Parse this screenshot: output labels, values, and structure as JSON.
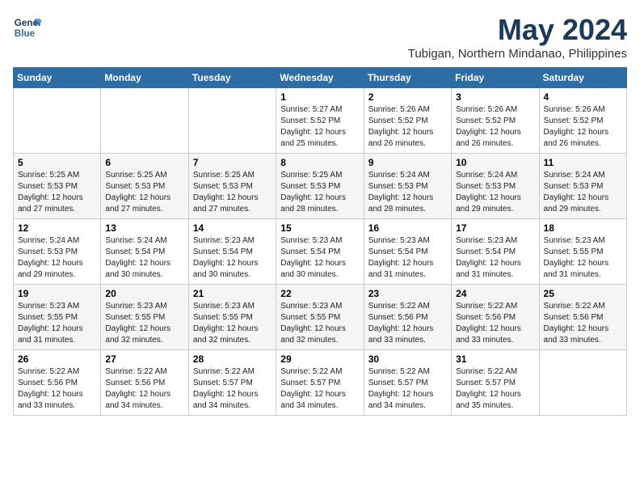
{
  "logo": {
    "line1": "General",
    "line2": "Blue"
  },
  "title": "May 2024",
  "location": "Tubigan, Northern Mindanao, Philippines",
  "headers": [
    "Sunday",
    "Monday",
    "Tuesday",
    "Wednesday",
    "Thursday",
    "Friday",
    "Saturday"
  ],
  "weeks": [
    [
      {
        "day": "",
        "info": ""
      },
      {
        "day": "",
        "info": ""
      },
      {
        "day": "",
        "info": ""
      },
      {
        "day": "1",
        "info": "Sunrise: 5:27 AM\nSunset: 5:52 PM\nDaylight: 12 hours\nand 25 minutes."
      },
      {
        "day": "2",
        "info": "Sunrise: 5:26 AM\nSunset: 5:52 PM\nDaylight: 12 hours\nand 26 minutes."
      },
      {
        "day": "3",
        "info": "Sunrise: 5:26 AM\nSunset: 5:52 PM\nDaylight: 12 hours\nand 26 minutes."
      },
      {
        "day": "4",
        "info": "Sunrise: 5:26 AM\nSunset: 5:52 PM\nDaylight: 12 hours\nand 26 minutes."
      }
    ],
    [
      {
        "day": "5",
        "info": "Sunrise: 5:25 AM\nSunset: 5:53 PM\nDaylight: 12 hours\nand 27 minutes."
      },
      {
        "day": "6",
        "info": "Sunrise: 5:25 AM\nSunset: 5:53 PM\nDaylight: 12 hours\nand 27 minutes."
      },
      {
        "day": "7",
        "info": "Sunrise: 5:25 AM\nSunset: 5:53 PM\nDaylight: 12 hours\nand 27 minutes."
      },
      {
        "day": "8",
        "info": "Sunrise: 5:25 AM\nSunset: 5:53 PM\nDaylight: 12 hours\nand 28 minutes."
      },
      {
        "day": "9",
        "info": "Sunrise: 5:24 AM\nSunset: 5:53 PM\nDaylight: 12 hours\nand 28 minutes."
      },
      {
        "day": "10",
        "info": "Sunrise: 5:24 AM\nSunset: 5:53 PM\nDaylight: 12 hours\nand 29 minutes."
      },
      {
        "day": "11",
        "info": "Sunrise: 5:24 AM\nSunset: 5:53 PM\nDaylight: 12 hours\nand 29 minutes."
      }
    ],
    [
      {
        "day": "12",
        "info": "Sunrise: 5:24 AM\nSunset: 5:53 PM\nDaylight: 12 hours\nand 29 minutes."
      },
      {
        "day": "13",
        "info": "Sunrise: 5:24 AM\nSunset: 5:54 PM\nDaylight: 12 hours\nand 30 minutes."
      },
      {
        "day": "14",
        "info": "Sunrise: 5:23 AM\nSunset: 5:54 PM\nDaylight: 12 hours\nand 30 minutes."
      },
      {
        "day": "15",
        "info": "Sunrise: 5:23 AM\nSunset: 5:54 PM\nDaylight: 12 hours\nand 30 minutes."
      },
      {
        "day": "16",
        "info": "Sunrise: 5:23 AM\nSunset: 5:54 PM\nDaylight: 12 hours\nand 31 minutes."
      },
      {
        "day": "17",
        "info": "Sunrise: 5:23 AM\nSunset: 5:54 PM\nDaylight: 12 hours\nand 31 minutes."
      },
      {
        "day": "18",
        "info": "Sunrise: 5:23 AM\nSunset: 5:55 PM\nDaylight: 12 hours\nand 31 minutes."
      }
    ],
    [
      {
        "day": "19",
        "info": "Sunrise: 5:23 AM\nSunset: 5:55 PM\nDaylight: 12 hours\nand 31 minutes."
      },
      {
        "day": "20",
        "info": "Sunrise: 5:23 AM\nSunset: 5:55 PM\nDaylight: 12 hours\nand 32 minutes."
      },
      {
        "day": "21",
        "info": "Sunrise: 5:23 AM\nSunset: 5:55 PM\nDaylight: 12 hours\nand 32 minutes."
      },
      {
        "day": "22",
        "info": "Sunrise: 5:23 AM\nSunset: 5:55 PM\nDaylight: 12 hours\nand 32 minutes."
      },
      {
        "day": "23",
        "info": "Sunrise: 5:22 AM\nSunset: 5:56 PM\nDaylight: 12 hours\nand 33 minutes."
      },
      {
        "day": "24",
        "info": "Sunrise: 5:22 AM\nSunset: 5:56 PM\nDaylight: 12 hours\nand 33 minutes."
      },
      {
        "day": "25",
        "info": "Sunrise: 5:22 AM\nSunset: 5:56 PM\nDaylight: 12 hours\nand 33 minutes."
      }
    ],
    [
      {
        "day": "26",
        "info": "Sunrise: 5:22 AM\nSunset: 5:56 PM\nDaylight: 12 hours\nand 33 minutes."
      },
      {
        "day": "27",
        "info": "Sunrise: 5:22 AM\nSunset: 5:56 PM\nDaylight: 12 hours\nand 34 minutes."
      },
      {
        "day": "28",
        "info": "Sunrise: 5:22 AM\nSunset: 5:57 PM\nDaylight: 12 hours\nand 34 minutes."
      },
      {
        "day": "29",
        "info": "Sunrise: 5:22 AM\nSunset: 5:57 PM\nDaylight: 12 hours\nand 34 minutes."
      },
      {
        "day": "30",
        "info": "Sunrise: 5:22 AM\nSunset: 5:57 PM\nDaylight: 12 hours\nand 34 minutes."
      },
      {
        "day": "31",
        "info": "Sunrise: 5:22 AM\nSunset: 5:57 PM\nDaylight: 12 hours\nand 35 minutes."
      },
      {
        "day": "",
        "info": ""
      }
    ]
  ]
}
